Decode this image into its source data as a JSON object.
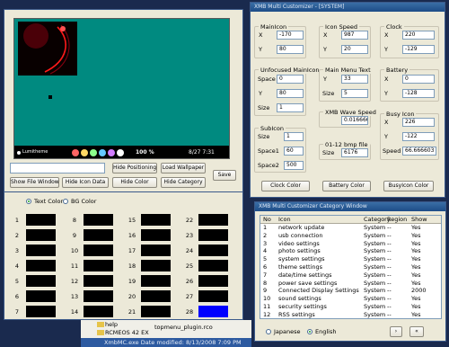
{
  "preview": {
    "theme_label": "Lumitheme",
    "percent": "100 %",
    "clock": "8/27 7:31"
  },
  "main_buttons": {
    "hide_positioning": "Hide Positioning",
    "load_wallpaper": "Load Wallpaper",
    "show_file_window": "Show File Window",
    "hide_icon_data": "Hide Icon Data",
    "hide_color": "Hide Color",
    "hide_category": "Hide Category",
    "save": "Save"
  },
  "customizer": {
    "title": "XMB Multi Customizer - [SYSTEM]",
    "main_icon": {
      "title": "MainIcon",
      "x_label": "X",
      "x": "-170",
      "y_label": "Y",
      "y": "80"
    },
    "icon_speed": {
      "title": "Icon Speed",
      "x_label": "X",
      "x": "987",
      "y_label": "Y",
      "y": "20"
    },
    "clock": {
      "title": "Clock",
      "x_label": "X",
      "x": "220",
      "y_label": "Y",
      "y": "-129"
    },
    "unfocused": {
      "title": "Unfocused MainIcon",
      "space_label": "Space",
      "space": "0",
      "y_label": "Y",
      "y": "80",
      "size_label": "Size",
      "size": "1"
    },
    "menu_text": {
      "title": "Main Menu Text",
      "y_label": "Y",
      "y": "33",
      "size_label": "Size",
      "size": "5"
    },
    "battery": {
      "title": "Battery",
      "x_label": "X",
      "x": "0",
      "y_label": "Y",
      "y": "-128"
    },
    "wave_speed": {
      "title": "XMB Wave Speed",
      "value": "0.0166666"
    },
    "busy_icon": {
      "title": "Busy Icon",
      "x_label": "X",
      "x": "226",
      "y_label": "Y",
      "y": "-122",
      "speed_label": "Speed",
      "speed": "66.666603"
    },
    "subicon": {
      "title": "SubIcon",
      "size_label": "Size",
      "size": "1",
      "space1_label": "Space1",
      "space1": "60",
      "space2_label": "Space2",
      "space2": "500"
    },
    "bmp": {
      "title": "01-12 bmp file",
      "size_label": "Size",
      "size": "6176"
    },
    "buttons": {
      "clock_color": "Clock Color",
      "battery_color": "Battery Color",
      "busy_icon_color": "BusyIcon Color"
    }
  },
  "color_panel": {
    "text_color": "Text Color",
    "bg_color": "BG Color",
    "cells": [
      {
        "n": "1",
        "c": "#000000"
      },
      {
        "n": "2",
        "c": "#000000"
      },
      {
        "n": "3",
        "c": "#000000"
      },
      {
        "n": "4",
        "c": "#000000"
      },
      {
        "n": "5",
        "c": "#000000"
      },
      {
        "n": "6",
        "c": "#000000"
      },
      {
        "n": "7",
        "c": "#000000"
      },
      {
        "n": "8",
        "c": "#000000"
      },
      {
        "n": "9",
        "c": "#000000"
      },
      {
        "n": "10",
        "c": "#000000"
      },
      {
        "n": "11",
        "c": "#000000"
      },
      {
        "n": "12",
        "c": "#000000"
      },
      {
        "n": "13",
        "c": "#000000"
      },
      {
        "n": "14",
        "c": "#000000"
      },
      {
        "n": "15",
        "c": "#000000"
      },
      {
        "n": "16",
        "c": "#000000"
      },
      {
        "n": "17",
        "c": "#000000"
      },
      {
        "n": "18",
        "c": "#000000"
      },
      {
        "n": "19",
        "c": "#000000"
      },
      {
        "n": "20",
        "c": "#000000"
      },
      {
        "n": "21",
        "c": "#000000"
      },
      {
        "n": "22",
        "c": "#000000"
      },
      {
        "n": "23",
        "c": "#000000"
      },
      {
        "n": "24",
        "c": "#000000"
      },
      {
        "n": "25",
        "c": "#000000"
      },
      {
        "n": "26",
        "c": "#000000"
      },
      {
        "n": "27",
        "c": "#000000"
      },
      {
        "n": "28",
        "c": "#0000ff"
      }
    ]
  },
  "category": {
    "title": "XMB Multi Customizer Category Window",
    "headers": [
      "No",
      "Icon",
      "Category",
      "Region",
      "Show"
    ],
    "rows": [
      [
        "1",
        "network update",
        "System",
        "--",
        "Yes"
      ],
      [
        "2",
        "usb connection",
        "System",
        "--",
        "Yes"
      ],
      [
        "3",
        "video settings",
        "System",
        "--",
        "Yes"
      ],
      [
        "4",
        "photo settings",
        "System",
        "--",
        "Yes"
      ],
      [
        "5",
        "system settings",
        "System",
        "--",
        "Yes"
      ],
      [
        "6",
        "theme settings",
        "System",
        "--",
        "Yes"
      ],
      [
        "7",
        "date/time settings",
        "System",
        "--",
        "Yes"
      ],
      [
        "8",
        "power save settings",
        "System",
        "--",
        "Yes"
      ],
      [
        "9",
        "Connected Display Settings",
        "System",
        "--",
        "2000"
      ],
      [
        "10",
        "sound settings",
        "System",
        "--",
        "Yes"
      ],
      [
        "11",
        "security settings",
        "System",
        "--",
        "Yes"
      ],
      [
        "12",
        "RSS settings",
        "System",
        "--",
        "Yes"
      ]
    ],
    "japanese": "Japanese",
    "english": "English",
    "nav_next": "›",
    "nav_back": "«"
  },
  "taskbar": {
    "help": "help",
    "folder": "RCMEOS 42 EX",
    "plugin_file": "topmenu_plugin.rco",
    "exe_info": "XmbMC.exe  Date modified: 8/13/2008 7:09 PM"
  },
  "colors": {
    "accent": "#3a6ea5",
    "selected_cell": "#0000ff",
    "preview_bg": "#008a80"
  }
}
